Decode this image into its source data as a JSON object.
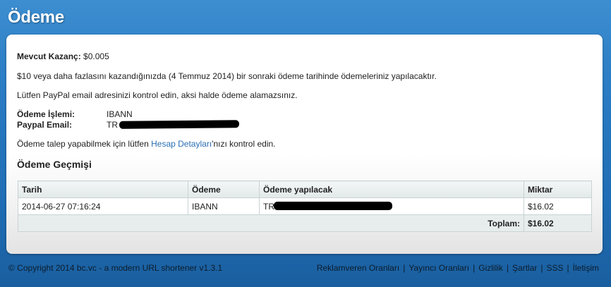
{
  "page": {
    "title": "Ödeme"
  },
  "earnings": {
    "label": "Mevcut Kazanç:",
    "value": "$0.005"
  },
  "notice_payment_date": "$10 veya daha fazlasını kazandığınızda (4 Temmuz 2014) bir sonraki ödeme tarihinde ödemeleriniz yapılacaktır.",
  "notice_paypal": "Lütfen PayPal email adresinizi kontrol edin, aksi halde ödeme alamazsınız.",
  "payment_info": {
    "method_label": "Ödeme İşlemi:",
    "method_value": "IBANN",
    "paypal_label": "Paypal Email:",
    "paypal_value_prefix": "TR"
  },
  "account_notice": {
    "before": "Ödeme talep yapabilmek için lütfen ",
    "link": "Hesap Detayları",
    "after": "'nızı kontrol edin."
  },
  "history": {
    "title": "Ödeme Geçmişi",
    "columns": [
      "Tarih",
      "Ödeme",
      "Ödeme yapılacak",
      "Miktar"
    ],
    "rows": [
      {
        "date": "2014-06-27 07:16:24",
        "method": "IBANN",
        "recipient_prefix": "TR",
        "amount": "$16.02"
      }
    ],
    "total_label": "Toplam:",
    "total_value": "$16.02"
  },
  "footer": {
    "copyright": "© Copyright 2014 bc.vc - a modern URL shortener v1.3.1",
    "links": [
      "Reklamveren Oranları",
      "Yayıncı Oranları",
      "Gizlilik",
      "Şartlar",
      "SSS",
      "İletişim"
    ]
  }
}
